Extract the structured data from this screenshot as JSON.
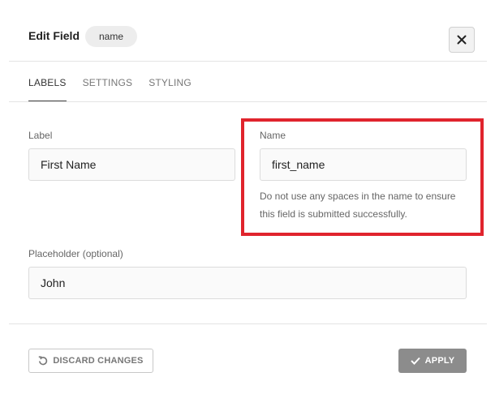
{
  "header": {
    "title": "Edit Field",
    "field_badge": "name",
    "close_icon": "close-icon"
  },
  "tabs": [
    {
      "label": "LABELS",
      "active": true
    },
    {
      "label": "SETTINGS",
      "active": false
    },
    {
      "label": "STYLING",
      "active": false
    }
  ],
  "form": {
    "label_field": {
      "label": "Label",
      "value": "First Name"
    },
    "name_field": {
      "label": "Name",
      "value": "first_name",
      "help": "Do not use any spaces in the name to ensure this field is submitted successfully."
    },
    "placeholder_field": {
      "label": "Placeholder (optional)",
      "value": "John"
    }
  },
  "footer": {
    "discard_label": "DISCARD CHANGES",
    "discard_icon": "undo-icon",
    "apply_label": "APPLY",
    "apply_icon": "checkmark-icon"
  },
  "colors": {
    "highlight": "#e0242d",
    "apply_bg": "#8c8c8c"
  }
}
